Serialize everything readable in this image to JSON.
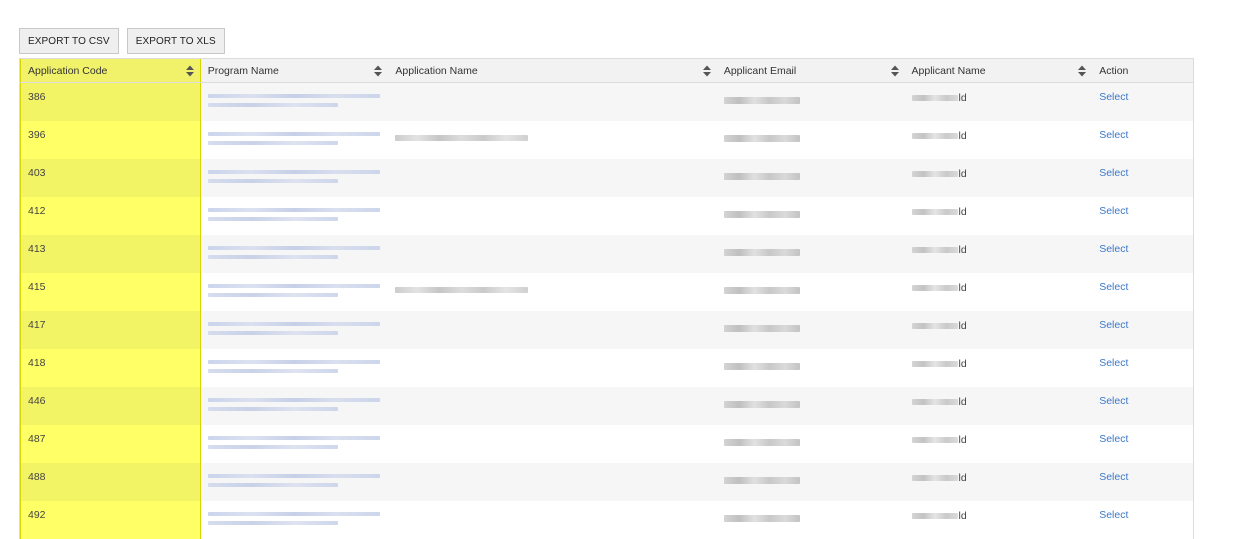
{
  "toolbar": {
    "export_csv": "EXPORT TO CSV",
    "export_xls": "EXPORT TO XLS"
  },
  "table": {
    "columns": [
      "Application Code",
      "Program Name",
      "Application Name",
      "Applicant Email",
      "Applicant Name",
      "Action"
    ],
    "rows": [
      {
        "code": "386",
        "has_app_name": false,
        "name_suffix": "ld",
        "action": "Select"
      },
      {
        "code": "396",
        "has_app_name": true,
        "name_suffix": "ld",
        "action": "Select"
      },
      {
        "code": "403",
        "has_app_name": false,
        "name_suffix": "ld",
        "action": "Select"
      },
      {
        "code": "412",
        "has_app_name": false,
        "name_suffix": "ld",
        "action": "Select"
      },
      {
        "code": "413",
        "has_app_name": false,
        "name_suffix": "ld",
        "action": "Select"
      },
      {
        "code": "415",
        "has_app_name": true,
        "name_suffix": "ld",
        "action": "Select"
      },
      {
        "code": "417",
        "has_app_name": false,
        "name_suffix": "ld",
        "action": "Select"
      },
      {
        "code": "418",
        "has_app_name": false,
        "name_suffix": "ld",
        "action": "Select"
      },
      {
        "code": "446",
        "has_app_name": false,
        "name_suffix": "ld",
        "action": "Select"
      },
      {
        "code": "487",
        "has_app_name": false,
        "name_suffix": "ld",
        "action": "Select"
      },
      {
        "code": "488",
        "has_app_name": false,
        "name_suffix": "ld",
        "action": "Select"
      },
      {
        "code": "492",
        "has_app_name": false,
        "name_suffix": "ld",
        "action": "Select"
      }
    ]
  },
  "colors": {
    "highlight_column": "#ffff66",
    "link": "#3b78c9"
  },
  "icons": {
    "sort": "sort-icon"
  }
}
